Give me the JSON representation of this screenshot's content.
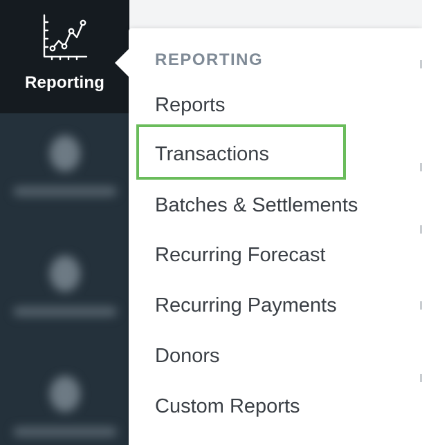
{
  "sidebar": {
    "active_item": {
      "label": "Reporting",
      "icon": "line-chart-icon"
    }
  },
  "dropdown": {
    "header": "REPORTING",
    "items": [
      {
        "label": "Reports"
      },
      {
        "label": "Transactions",
        "highlighted": true
      },
      {
        "label": "Batches & Settlements"
      },
      {
        "label": "Recurring Forecast"
      },
      {
        "label": "Recurring Payments"
      },
      {
        "label": "Donors"
      },
      {
        "label": "Custom Reports"
      }
    ],
    "highlight_color": "#6abc5b"
  },
  "colors": {
    "sidebar_bg": "#24313b",
    "sidebar_active_bg": "#151b20",
    "menu_text": "#3a3f45",
    "menu_header_text": "#7f8a96"
  }
}
